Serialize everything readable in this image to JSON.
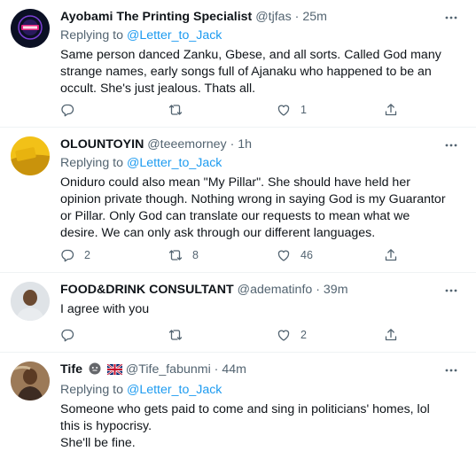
{
  "tweets": [
    {
      "name": "Ayobami The Printing Specialist",
      "handle": "@tjfas",
      "time": "25m",
      "replying_prefix": "Replying to",
      "replying_to": "@Letter_to_Jack",
      "text": "Same person danced Zanku, Gbese, and all sorts. Called God many strange names, early songs full of Ajanaku who happened to be an occult. She's just jealous. Thats all.",
      "replies": "",
      "retweets": "",
      "likes": "1"
    },
    {
      "name": "OLOUNTOYIN",
      "handle": "@teeemorney",
      "time": "1h",
      "replying_prefix": "Replying to",
      "replying_to": "@Letter_to_Jack",
      "text": "Oniduro could also mean \"My Pillar\". She should have held her opinion private though. Nothing wrong in saying God is my Guarantor or Pillar. Only God can translate our requests to mean what we desire. We can only ask through our different languages.",
      "replies": "2",
      "retweets": "8",
      "likes": "46"
    },
    {
      "name": "FOOD&DRINK CONSULTANT",
      "handle": "@adematinfo",
      "time": "39m",
      "text": "I agree with you",
      "replies": "",
      "retweets": "",
      "likes": "2"
    },
    {
      "name": "Tife",
      "handle": "@Tife_fabunmi",
      "time": "44m",
      "replying_prefix": "Replying to",
      "replying_to": "@Letter_to_Jack",
      "text_lines": [
        "Someone who gets paid to come and sing in politicians' homes, lol this is hypocrisy.",
        "She'll be fine."
      ]
    }
  ],
  "separator": "·"
}
